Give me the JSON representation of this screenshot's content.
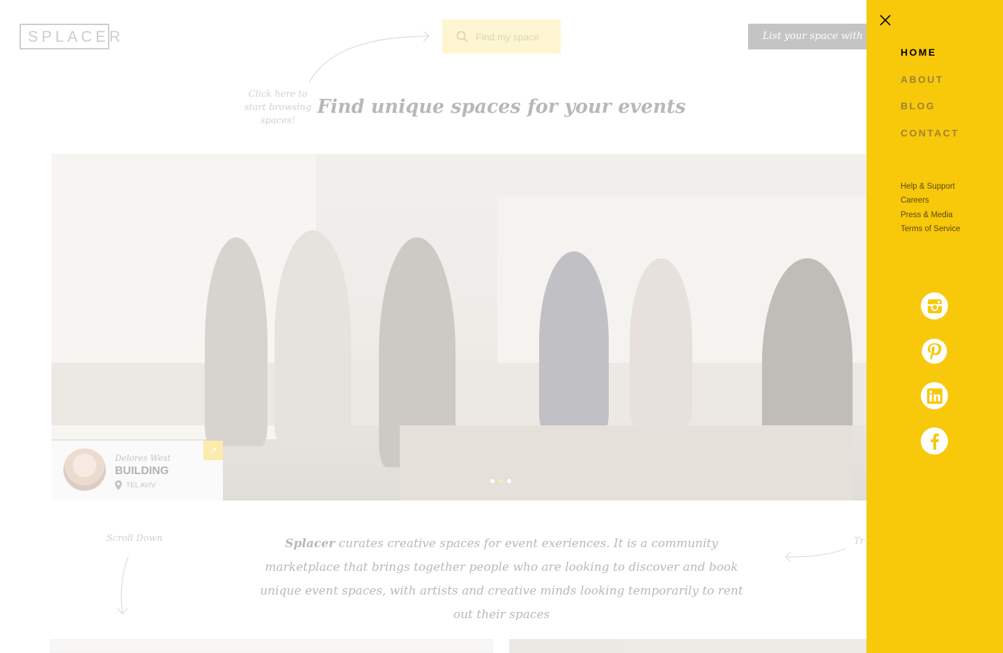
{
  "header": {
    "logo_text": "SPLACER",
    "search_placeholder": "Find my space",
    "list_space_label": "List your space with us"
  },
  "hints": {
    "browse": "Click here to start browsing spaces!",
    "scroll": "Scroll Down",
    "right_partial": "Tr"
  },
  "hero": {
    "headline": "Find unique spaces for your events",
    "slide_count": 3,
    "active_slide": 2,
    "host": {
      "name": "Delores West",
      "space_type": "BUILDING",
      "location": "TEL AVIV"
    }
  },
  "about": {
    "brand": "Splacer",
    "text": "curates creative spaces for event exeriences. It is a community marketplace that brings together people who are looking to discover and book unique event spaces, with artists and creative minds looking temporarily to rent out their spaces"
  },
  "menu": {
    "nav": [
      {
        "label": "HOME",
        "active": true
      },
      {
        "label": "ABOUT",
        "active": false
      },
      {
        "label": "BLOG",
        "active": false
      },
      {
        "label": "CONTACT",
        "active": false
      }
    ],
    "links": [
      "Help & Support",
      "Careers",
      "Press & Media",
      "Terms of Service"
    ],
    "social": [
      "instagram-icon",
      "pinterest-icon",
      "linkedin-icon",
      "facebook-icon"
    ]
  },
  "colors": {
    "accent": "#f8c80a",
    "menu_active": "#000000",
    "menu_inactive": "#9d8233"
  }
}
